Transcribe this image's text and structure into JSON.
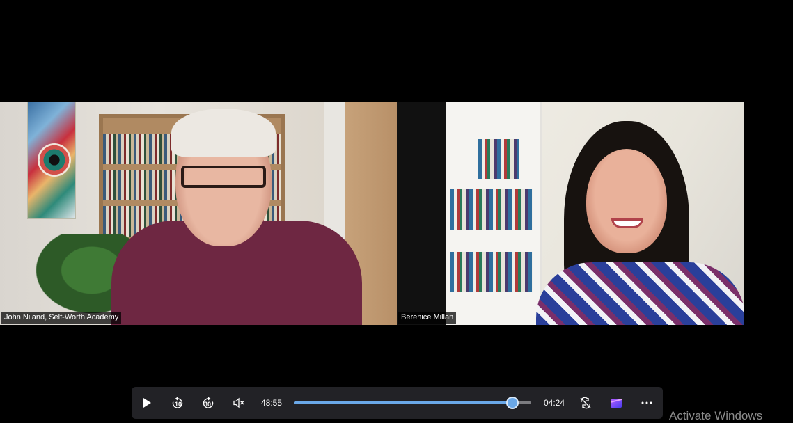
{
  "participants": [
    {
      "name": "John Niland, Self-Worth Academy"
    },
    {
      "name": "Berenice Millan"
    }
  ],
  "player": {
    "elapsed": "48:55",
    "remaining": "04:24",
    "progress": 0.92,
    "skip_back_label": "10",
    "skip_forward_label": "30",
    "accent_color": "#6aa8e8",
    "icons": {
      "play": "play-icon",
      "skip_back": "rewind-10-icon",
      "skip_forward": "forward-30-icon",
      "volume": "mute-icon",
      "repeat": "repeat-off-icon",
      "app": "clipchamp-icon",
      "more": "more-icon"
    }
  },
  "watermark": "Activate Windows"
}
